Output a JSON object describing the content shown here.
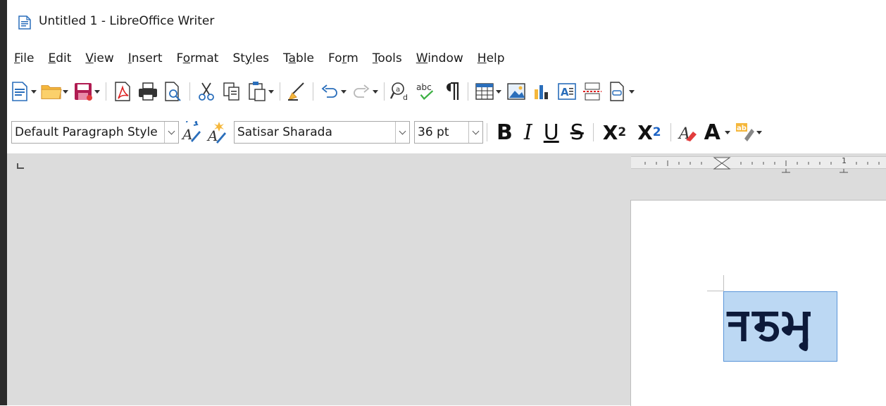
{
  "window": {
    "title": "Untitled 1 - LibreOffice Writer",
    "icon": "writer-document-icon"
  },
  "menu": [
    {
      "label": "File",
      "mnemonic": "F",
      "rest": "ile"
    },
    {
      "label": "Edit",
      "mnemonic": "E",
      "rest": "dit"
    },
    {
      "label": "View",
      "mnemonic": "V",
      "rest": "iew"
    },
    {
      "label": "Insert",
      "mnemonic": "I",
      "rest": "nsert"
    },
    {
      "label": "Format",
      "pre": "F",
      "mnemonic": "o",
      "rest": "rmat"
    },
    {
      "label": "Styles",
      "pre": "St",
      "mnemonic": "y",
      "rest": "les"
    },
    {
      "label": "Table",
      "pre": "T",
      "mnemonic": "a",
      "rest": "ble"
    },
    {
      "label": "Form",
      "pre": "Fo",
      "mnemonic": "r",
      "rest": "m"
    },
    {
      "label": "Tools",
      "mnemonic": "T",
      "rest": "ools"
    },
    {
      "label": "Window",
      "mnemonic": "W",
      "rest": "indow"
    },
    {
      "label": "Help",
      "mnemonic": "H",
      "rest": "elp"
    }
  ],
  "formatting": {
    "paragraph_style": "Default Paragraph Style",
    "font_name": "Satisar Sharada",
    "font_size": "36 pt",
    "bold": "B",
    "italic": "I",
    "underline": "U",
    "strikethrough": "S",
    "superscript_base": "X",
    "superscript_mark": "2",
    "subscript_base": "X",
    "subscript_mark": "2",
    "font_color": "A"
  },
  "ruler": {
    "number": "1"
  },
  "document": {
    "selected_text": "𑆤𑆨𑆩𑆶"
  },
  "colors": {
    "selection": "#bcd8f3",
    "accent": "#1c63c5",
    "workspace": "#dcdcdc"
  }
}
